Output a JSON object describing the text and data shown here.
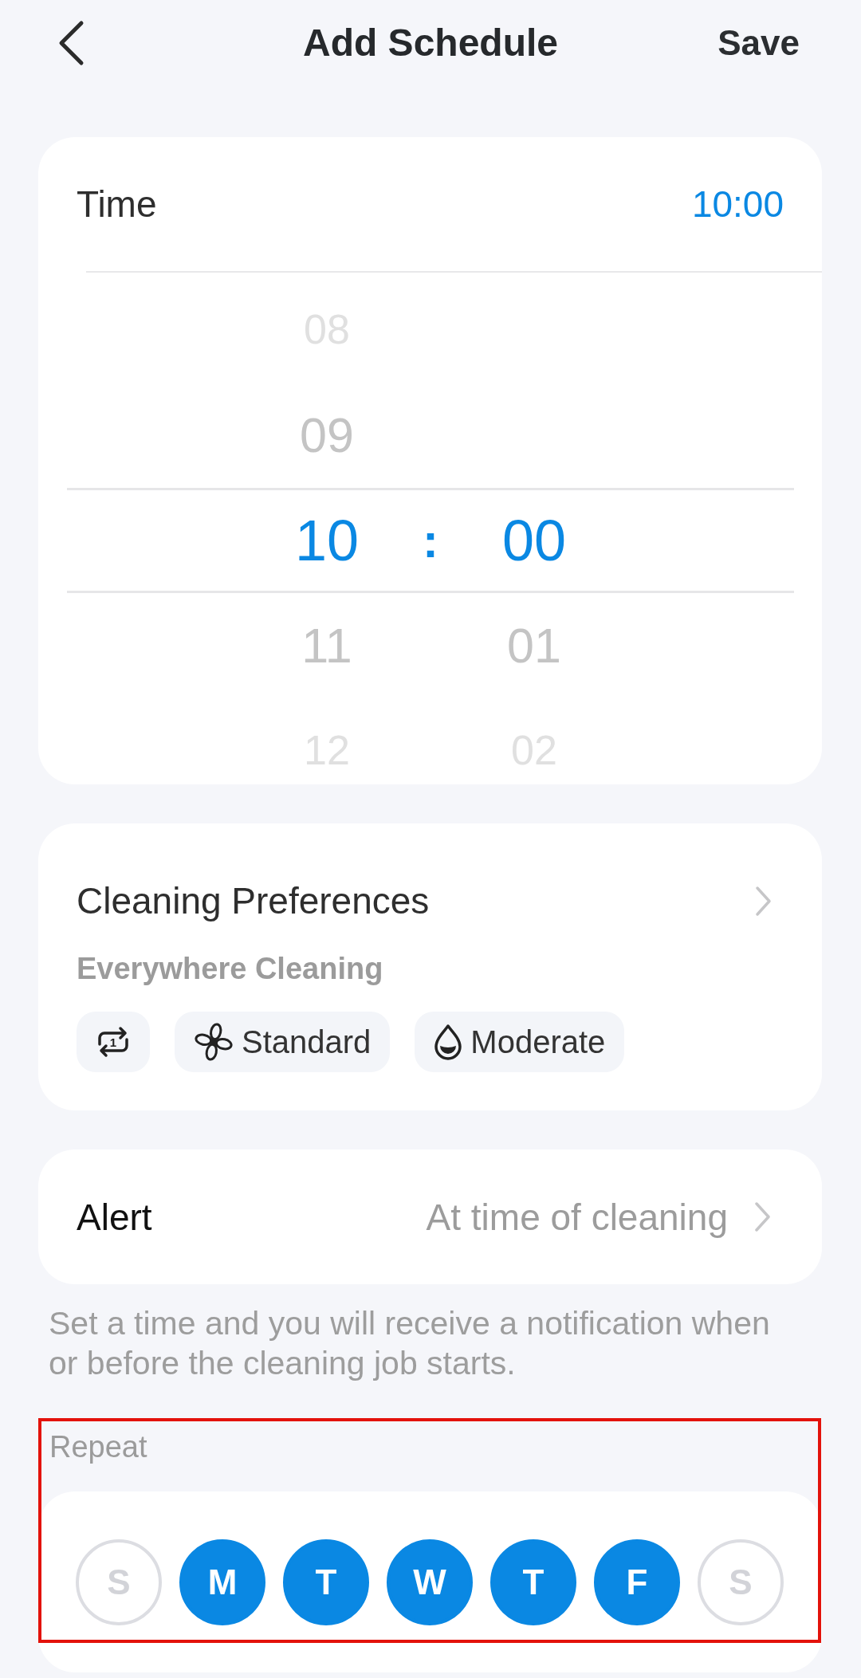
{
  "header": {
    "title": "Add Schedule",
    "save": "Save"
  },
  "time": {
    "label": "Time",
    "value": "10:00"
  },
  "time_picker": {
    "hours": [
      {
        "value": "08",
        "selected": false
      },
      {
        "value": "09",
        "selected": false
      },
      {
        "value": "10",
        "selected": true
      },
      {
        "value": "11",
        "selected": false
      },
      {
        "value": "12",
        "selected": false
      }
    ],
    "separator": ":",
    "minutes": [
      {
        "value": "00",
        "selected": true
      },
      {
        "value": "01",
        "selected": false
      },
      {
        "value": "02",
        "selected": false
      }
    ]
  },
  "cleaning_preferences": {
    "title": "Cleaning Preferences",
    "mode": "Everywhere Cleaning",
    "chips": [
      {
        "kind": "cycles",
        "count": "1"
      },
      {
        "kind": "fan",
        "label": "Standard"
      },
      {
        "kind": "water",
        "label": "Moderate"
      }
    ]
  },
  "alert": {
    "label": "Alert",
    "value": "At time of cleaning"
  },
  "note": "Set a time and you will receive a notification when or before the cleaning job starts.",
  "repeat": {
    "label": "Repeat",
    "highlighted": true,
    "days": [
      {
        "letter": "S",
        "selected": false
      },
      {
        "letter": "M",
        "selected": true
      },
      {
        "letter": "T",
        "selected": true
      },
      {
        "letter": "W",
        "selected": true
      },
      {
        "letter": "T",
        "selected": true
      },
      {
        "letter": "F",
        "selected": true
      },
      {
        "letter": "S",
        "selected": false
      }
    ]
  }
}
